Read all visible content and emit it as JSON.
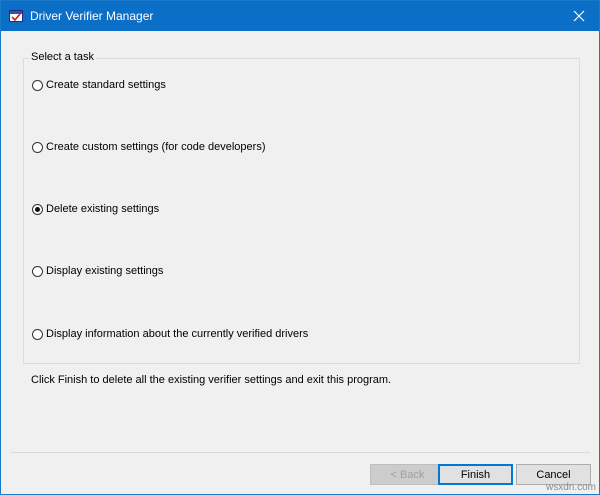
{
  "window": {
    "title": "Driver Verifier Manager",
    "icon": "driver-verifier-icon",
    "close_glyph": "✕"
  },
  "task_group": {
    "title": "Select a task",
    "options": [
      {
        "label": "Create standard settings",
        "checked": false
      },
      {
        "label": "Create custom settings (for code developers)",
        "checked": false
      },
      {
        "label": "Delete existing settings",
        "checked": true
      },
      {
        "label": "Display existing settings",
        "checked": false
      },
      {
        "label": "Display information about the currently verified drivers",
        "checked": false
      }
    ]
  },
  "description": "Click Finish to delete all the existing verifier settings and exit this program.",
  "buttons": {
    "back": "< Back",
    "finish": "Finish",
    "cancel": "Cancel"
  },
  "watermark": "wsxdn.com",
  "colors": {
    "titlebar": "#0b6fc8",
    "window_bg": "#f0f0f0",
    "default_button_border": "#0078d7"
  }
}
